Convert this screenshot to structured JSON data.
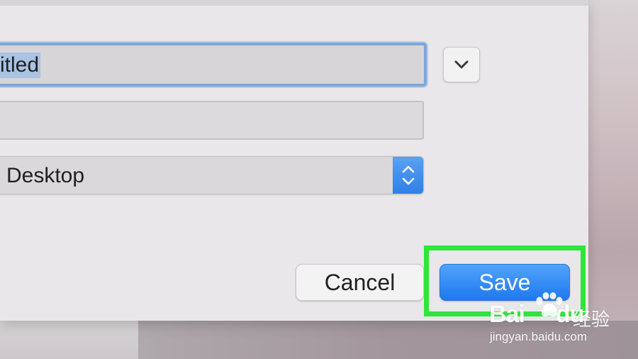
{
  "save_dialog": {
    "name_field": {
      "value": "itled"
    },
    "tags_field": {
      "value": ""
    },
    "where_popup": {
      "selected": "Desktop"
    },
    "buttons": {
      "cancel_label": "Cancel",
      "save_label": "Save"
    }
  },
  "watermark": {
    "brand": "Bai",
    "brand_suffix": "du",
    "cn_label": "经验",
    "url": "jingyan.baidu.com"
  },
  "icons": {
    "expand": "chevron-down-icon",
    "stepper": "up-down-stepper-icon",
    "paw": "baidu-paw-logo"
  },
  "colors": {
    "accent_blue": "#2f7fe5",
    "focus_ring": "#7ea6d8",
    "highlight_green": "#2ee53c",
    "dialog_bg": "#e9e7e9"
  }
}
